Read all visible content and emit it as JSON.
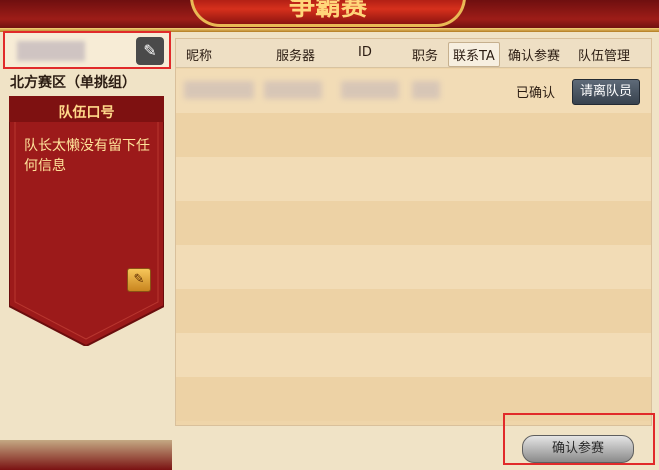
{
  "header": {
    "title": "争霸赛"
  },
  "team": {
    "name": "",
    "division": "北方赛区（单挑组）",
    "slogan_title": "队伍口号",
    "slogan_text": "队长太懒没有留下任何信息"
  },
  "table": {
    "columns": [
      "昵称",
      "服务器",
      "ID",
      "职务",
      "联系TA",
      "确认参赛",
      "队伍管理"
    ],
    "active_column": "联系TA",
    "rows": [
      {
        "status": "已确认",
        "action": "请离队员"
      }
    ]
  },
  "buttons": {
    "confirm": "确认参赛"
  },
  "icons": {
    "edit_name": "pencil-icon",
    "edit_slogan": "pencil-icon"
  },
  "colors": {
    "accent_red": "#9e1d18",
    "gold": "#e9b955",
    "highlight_box": "#e12a2a"
  }
}
